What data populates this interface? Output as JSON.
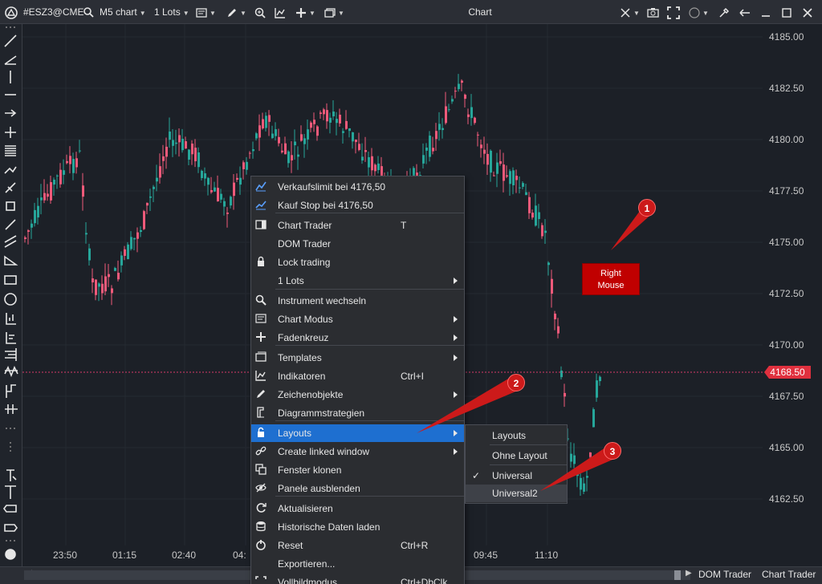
{
  "toolbar": {
    "instrument": "#ESZ3@CME",
    "chart_type": "M5 chart",
    "lots": "1 Lots",
    "title": "Chart"
  },
  "chart_data": {
    "type": "candlestick",
    "y_ticks": [
      "4185.00",
      "4182.50",
      "4180.00",
      "4177.50",
      "4175.00",
      "4172.50",
      "4170.00",
      "4167.50",
      "4165.00",
      "4162.50"
    ],
    "x_ticks": [
      "23:50",
      "01:15",
      "02:40",
      "04:",
      "09:45",
      "11:10"
    ],
    "last_price": "4168.50",
    "ylim": [
      4160.5,
      4186.0
    ],
    "colors": {
      "up": "#26a69a",
      "down": "#ef5a7a",
      "price_line": "#d63a6a"
    }
  },
  "context_menu": {
    "items": [
      {
        "label": "Verkaufslimit bei 4176,50",
        "icon": "sell-limit-icon"
      },
      {
        "label": "Kauf Stop bei 4176,50",
        "icon": "buy-stop-icon"
      },
      {
        "label": "Chart Trader",
        "shortcut": "T",
        "icon": "chart-trader-icon"
      },
      {
        "label": "DOM Trader",
        "icon": ""
      },
      {
        "label": "Lock trading",
        "icon": "lock-icon"
      },
      {
        "label": "1 Lots",
        "icon": "",
        "submenu": true
      },
      {
        "label": "Instrument wechseln",
        "icon": "search-icon"
      },
      {
        "label": "Chart Modus",
        "icon": "chart-mode-icon",
        "submenu": true
      },
      {
        "label": "Fadenkreuz",
        "icon": "crosshair-icon",
        "submenu": true
      },
      {
        "label": "Templates",
        "icon": "templates-icon",
        "submenu": true
      },
      {
        "label": "Indikatoren",
        "shortcut": "Ctrl+I",
        "icon": "indicators-icon"
      },
      {
        "label": "Zeichenobjekte",
        "icon": "pen-icon",
        "submenu": true
      },
      {
        "label": "Diagrammstrategien",
        "icon": "strategy-icon"
      },
      {
        "label": "Layouts",
        "icon": "lock-open-icon",
        "submenu": true,
        "highlighted": true
      },
      {
        "label": "Create linked window",
        "icon": "link-icon",
        "submenu": true
      },
      {
        "label": "Fenster klonen",
        "icon": "clone-icon"
      },
      {
        "label": "Panele ausblenden",
        "icon": "eye-off-icon"
      },
      {
        "label": "Aktualisieren",
        "icon": "refresh-icon"
      },
      {
        "label": "Historische Daten laden",
        "icon": "database-icon"
      },
      {
        "label": "Reset",
        "shortcut": "Ctrl+R",
        "icon": "reset-icon"
      },
      {
        "label": "Exportieren...",
        "icon": ""
      },
      {
        "label": "Vollbildmodus",
        "shortcut": "Ctrl+DbClk",
        "icon": "fullscreen-icon"
      }
    ]
  },
  "submenu": {
    "items": [
      {
        "label": "Layouts",
        "checked": false
      },
      {
        "label": "Ohne Layout",
        "checked": false
      },
      {
        "label": "Universal",
        "checked": true
      },
      {
        "label": "Universal2",
        "checked": false,
        "hovered": true
      }
    ]
  },
  "annotations": {
    "callout": [
      "Right",
      "Mouse"
    ],
    "badges": [
      "1",
      "2",
      "3"
    ]
  },
  "bottom_tabs": [
    "DOM Trader",
    "Chart Trader"
  ]
}
